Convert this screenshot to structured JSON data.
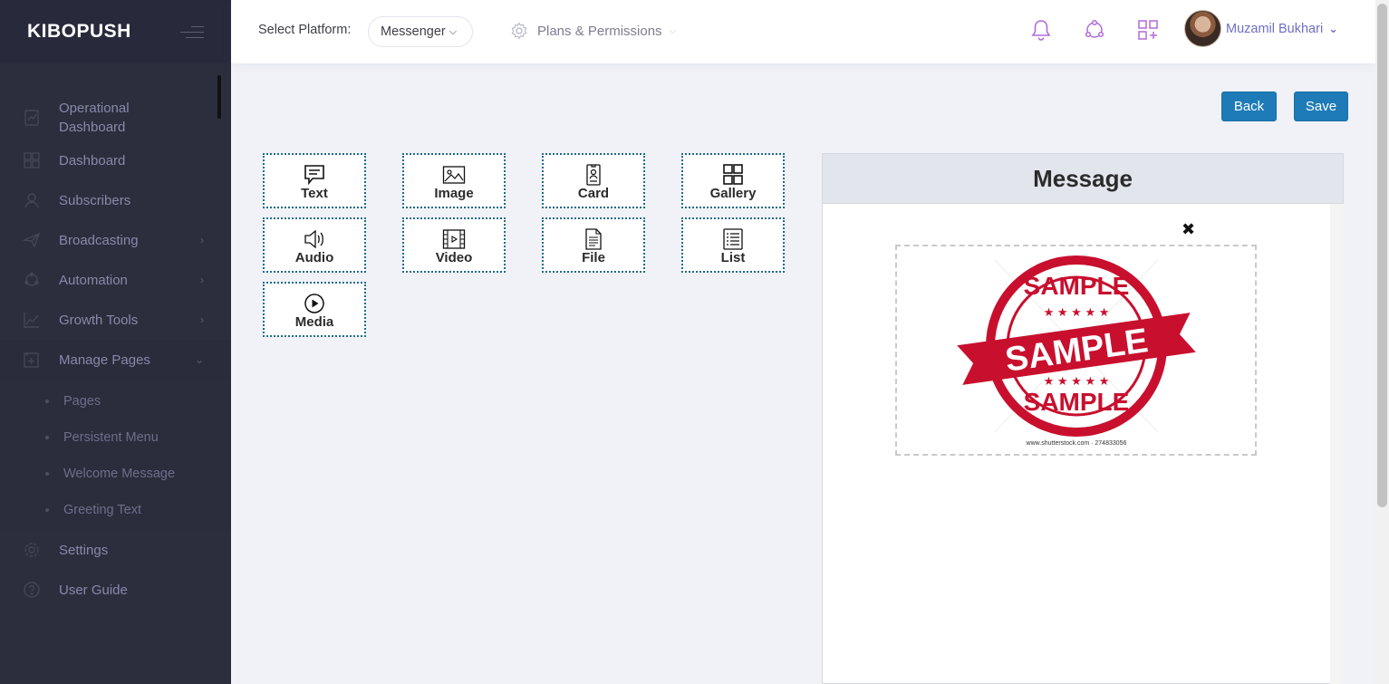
{
  "brand": "KIBOPUSH",
  "sidebar": {
    "items": [
      {
        "label": "Operational Dashboard"
      },
      {
        "label": "Dashboard"
      },
      {
        "label": "Subscribers"
      },
      {
        "label": "Broadcasting"
      },
      {
        "label": "Automation"
      },
      {
        "label": "Growth Tools"
      },
      {
        "label": "Manage Pages"
      },
      {
        "label": "Settings"
      },
      {
        "label": "User Guide"
      }
    ],
    "submenu": [
      "Pages",
      "Persistent Menu",
      "Welcome Message",
      "Greeting Text"
    ]
  },
  "header": {
    "platform_label": "Select Platform:",
    "platform_value": "Messenger",
    "plans_label": "Plans & Permissions",
    "user_name": "Muzamil Bukhari"
  },
  "actions": {
    "back": "Back",
    "save": "Save"
  },
  "components": [
    "Text",
    "Image",
    "Card",
    "Gallery",
    "Audio",
    "Video",
    "File",
    "List",
    "Media"
  ],
  "message": {
    "title": "Message",
    "close": "✖",
    "stamp_top": "SAMPLE",
    "stamp_middle": "SAMPLE",
    "stamp_bottom": "SAMPLE",
    "stamp_footer": "www.shutterstock.com · 274833056"
  },
  "colors": {
    "sidebar": "#2c2e3e",
    "accent": "#1e7bb8",
    "stamp": "#c8102e",
    "user": "#6f6ec6"
  }
}
